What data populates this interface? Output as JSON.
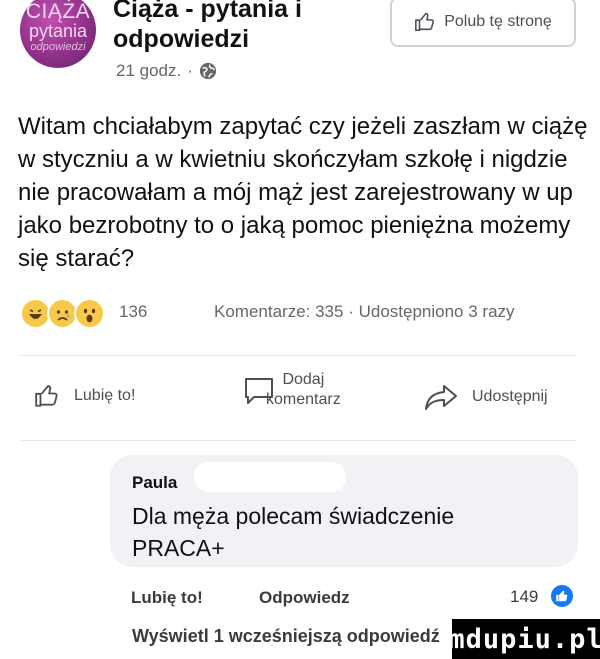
{
  "page": {
    "avatar_lines": [
      "CIĄŻA",
      "pytania",
      "odpowiedzi"
    ],
    "name_line1": "Ciąża - pytania i",
    "name_line2": "odpowiedzi",
    "time": "21 godz."
  },
  "follow_button": {
    "label": "Polub tę stronę"
  },
  "post": {
    "text": "Witam chciałabym zapytać czy jeżeli zaszłam w ciążę w styczniu a w kwietniu skończyłam szkołę i nigdzie nie pracowałam a mój mąż jest zarejestrowany w up jako bezrobotny to o jaką pomoc pieniężna możemy się starać?"
  },
  "stats": {
    "reactions_count": "136",
    "comments": "Komentarze: 335",
    "shares": "Udostępniono 3 razy"
  },
  "actions": {
    "like": "Lubię to!",
    "comment_line1": "Dodaj",
    "comment_line2": "komentarz",
    "share": "Udostępnij"
  },
  "comment": {
    "author": "Paula",
    "text": "Dla męża polecam świadczenie PRACA+",
    "like": "Lubię to!",
    "reply": "Odpowiedz",
    "likes_count": "149"
  },
  "more_replies": "Wyświetl 1 wcześniejszą odpowiedź",
  "watermark": "mdupiu.pl",
  "colors": {
    "accent": "#1877f2",
    "avatar": "#8b2f86"
  }
}
